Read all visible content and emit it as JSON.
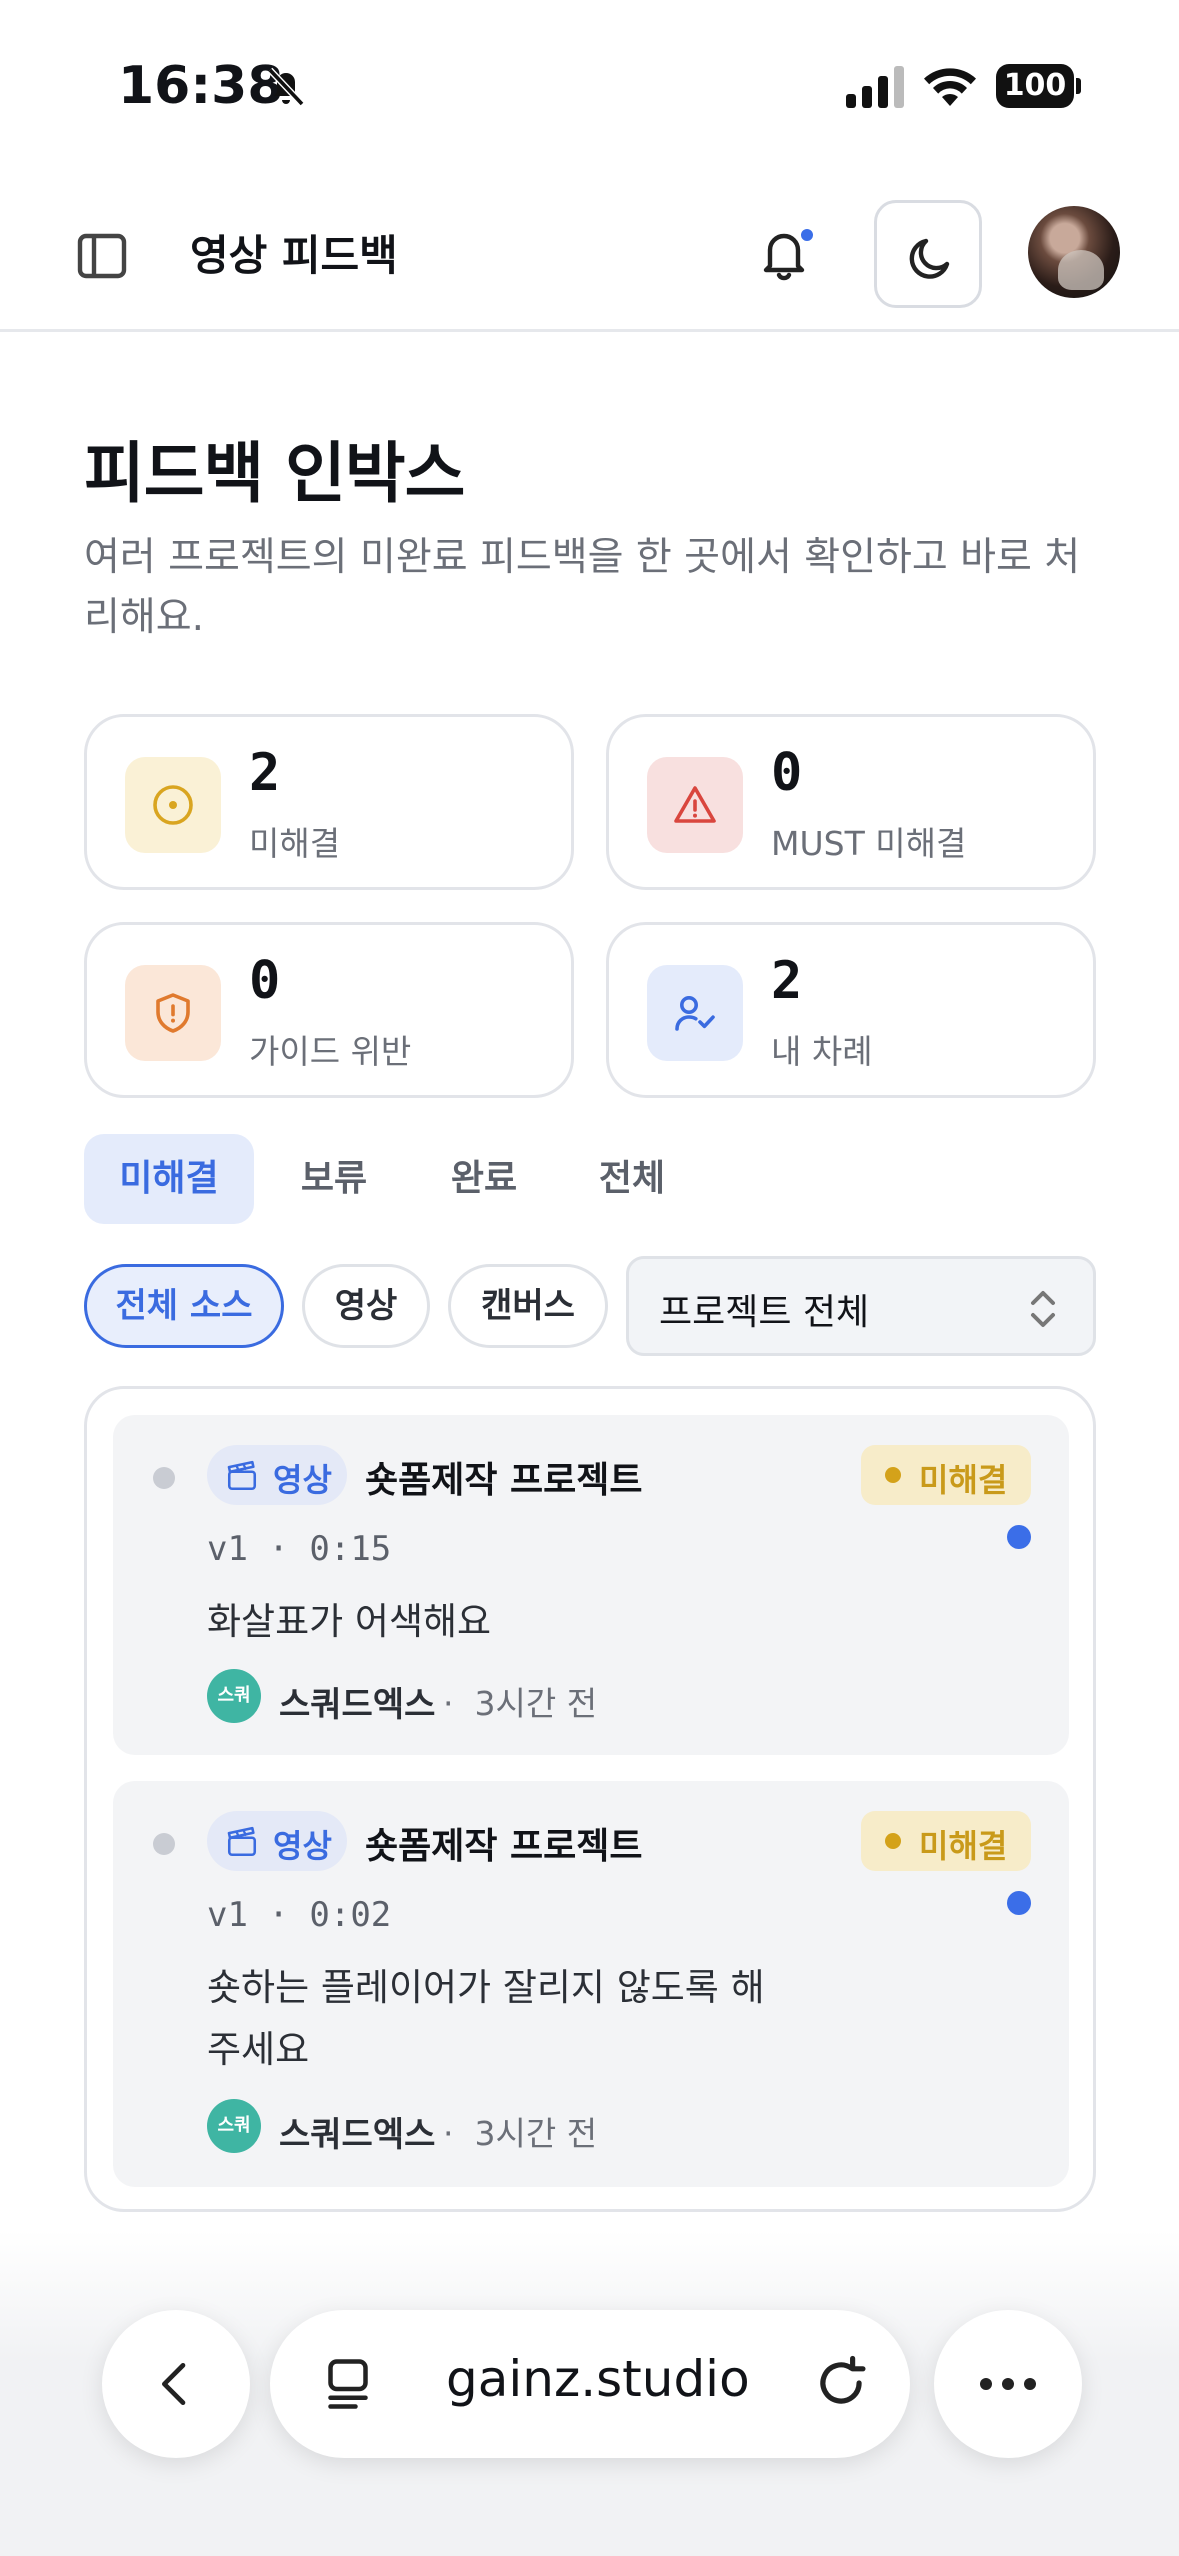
{
  "status_bar": {
    "time": "16:38",
    "battery": "100"
  },
  "header": {
    "title": "영상 피드백"
  },
  "page": {
    "title": "피드백 인박스",
    "description": "여러 프로젝트의 미완료 피드백을 한 곳에서 확인하고 바로 처리해요."
  },
  "stats": [
    {
      "value": "2",
      "label": "미해결",
      "icon": "clock-circle-icon",
      "color": "#d9a520"
    },
    {
      "value": "0",
      "label": "MUST 미해결",
      "icon": "warning-triangle-icon",
      "color": "#d9463e"
    },
    {
      "value": "0",
      "label": "가이드 위반",
      "icon": "shield-alert-icon",
      "color": "#e07a2e"
    },
    {
      "value": "2",
      "label": "내 차례",
      "icon": "user-check-icon",
      "color": "#3a6be0"
    }
  ],
  "tabs": [
    "미해결",
    "보류",
    "완료",
    "전체"
  ],
  "filters": {
    "chips": [
      "전체 소스",
      "영상",
      "캔버스"
    ],
    "project_select": "프로젝트 전체"
  },
  "items": [
    {
      "source": "영상",
      "project": "숏폼제작 프로젝트",
      "status": "미해결",
      "version": "v1",
      "timecode": "0:15",
      "text": "화살표가 어색해요",
      "author_initials": "스쿼",
      "author": "스쿼드엑스",
      "time_ago": "3시간 전"
    },
    {
      "source": "영상",
      "project": "숏폼제작 프로젝트",
      "status": "미해결",
      "version": "v1",
      "timecode": "0:02",
      "text": "숏하는 플레이어가 잘리지 않도록 해주세요",
      "author_initials": "스쿼",
      "author": "스쿼드엑스",
      "time_ago": "3시간 전"
    }
  ],
  "browser": {
    "url": "gainz.studio"
  },
  "colors": {
    "accent": "#3a6be0",
    "warning_bg": "#f7ecc9",
    "warning_fg": "#c99a1a",
    "avatar_teal": "#3fb5a3"
  }
}
